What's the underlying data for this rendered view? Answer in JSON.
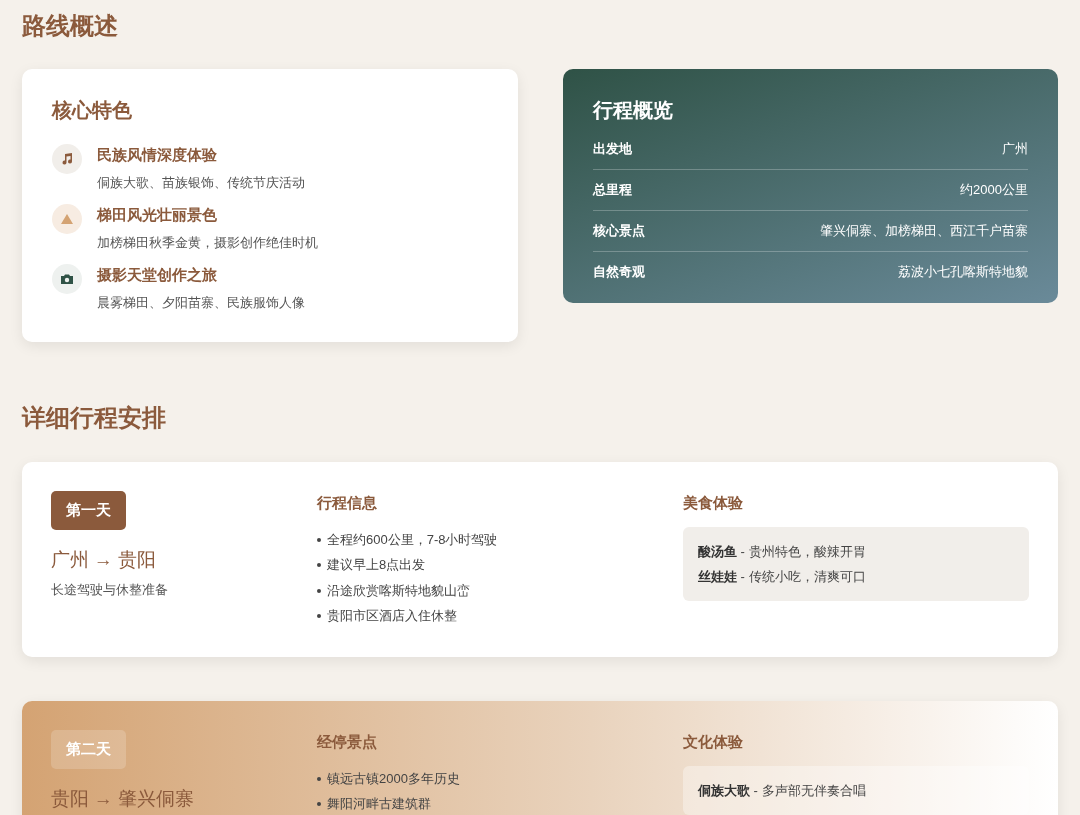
{
  "overview_section": {
    "heading": "路线概述",
    "features_card": {
      "title": "核心特色",
      "items": [
        {
          "kind": "music",
          "title": "民族风情深度体验",
          "description": "侗族大歌、苗族银饰、传统节庆活动"
        },
        {
          "kind": "mountain",
          "title": "梯田风光壮丽景色",
          "description": "加榜梯田秋季金黄，摄影创作绝佳时机"
        },
        {
          "kind": "camera",
          "title": "摄影天堂创作之旅",
          "description": "晨雾梯田、夕阳苗寨、民族服饰人像"
        }
      ]
    },
    "summary_card": {
      "title": "行程概览",
      "rows": [
        {
          "label": "出发地",
          "value": "广州"
        },
        {
          "label": "总里程",
          "value": "约2000公里"
        },
        {
          "label": "核心景点",
          "value": "肇兴侗寨、加榜梯田、西江千户苗寨"
        },
        {
          "label": "自然奇观",
          "value": "荔波小七孔喀斯特地貌"
        }
      ]
    }
  },
  "itinerary_section": {
    "heading": "详细行程安排",
    "days": [
      {
        "kind": "plain",
        "badge": "第一天",
        "route": "广州 → 贵阳",
        "subtitle": "长途驾驶与休整准备",
        "info_title": "行程信息",
        "info_items": [
          "全程约600公里，7-8小时驾驶",
          "建议早上8点出发",
          "沿途欣赏喀斯特地貌山峦",
          "贵阳市区酒店入住休整"
        ],
        "box_title": "美食体验",
        "box_items": [
          "**酸汤鱼** - 贵州特色，酸辣开胃",
          "**丝娃娃** - 传统小吃，清爽可口"
        ]
      },
      {
        "kind": "featured",
        "badge": "第二天",
        "route": "贵阳 → 肇兴侗寨",
        "info_title": "经停景点",
        "info_items": [
          "镇远古镇2000多年历史",
          "舞阳河畔古建筑群"
        ],
        "box_title": "文化体验",
        "box_items": [
          "**侗族大歌** - 多声部无伴奏合唱"
        ]
      }
    ]
  }
}
